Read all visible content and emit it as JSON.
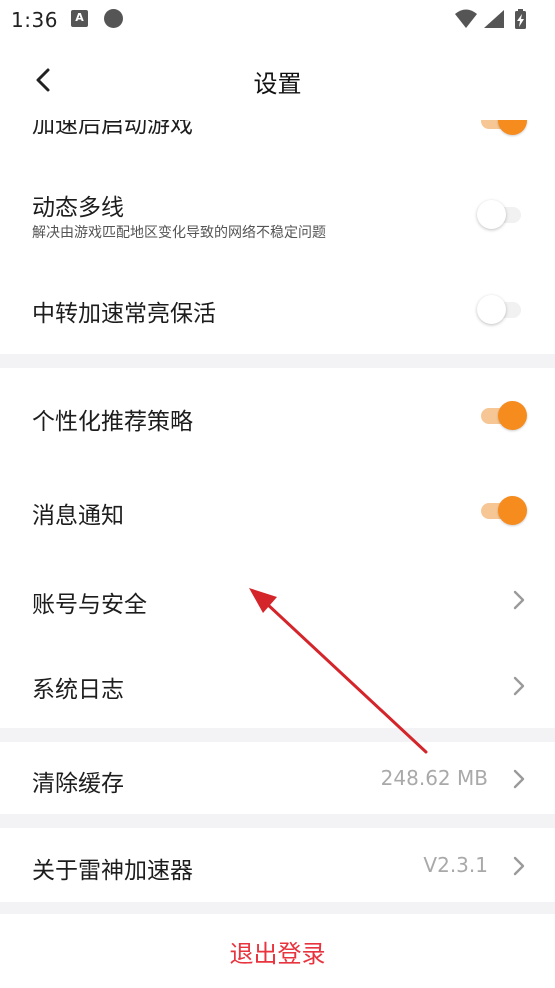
{
  "status_bar": {
    "time": "1:36",
    "a_glyph": "A"
  },
  "header": {
    "title": "设置"
  },
  "rows": {
    "start_game": {
      "label": "加速后启动游戏",
      "toggle": "on"
    },
    "dynamic_multiline": {
      "label": "动态多线",
      "sub": "解决由游戏匹配地区变化导致的网络不稳定问题",
      "toggle": "off"
    },
    "relay_keepalive": {
      "label": "中转加速常亮保活",
      "toggle": "off"
    },
    "personalized": {
      "label": "个性化推荐策略",
      "toggle": "on"
    },
    "notifications": {
      "label": "消息通知",
      "toggle": "on"
    },
    "account_security": {
      "label": "账号与安全"
    },
    "system_log": {
      "label": "系统日志"
    },
    "clear_cache": {
      "label": "清除缓存",
      "value": "248.62 MB"
    },
    "about": {
      "label": "关于雷神加速器",
      "value": "V2.3.1"
    }
  },
  "logout": {
    "label": "退出登录"
  },
  "colors": {
    "accent": "#f68b1e",
    "logout_text": "#e8343e",
    "arrow": "#d4252b",
    "gap_background": "#f3f3f5"
  }
}
